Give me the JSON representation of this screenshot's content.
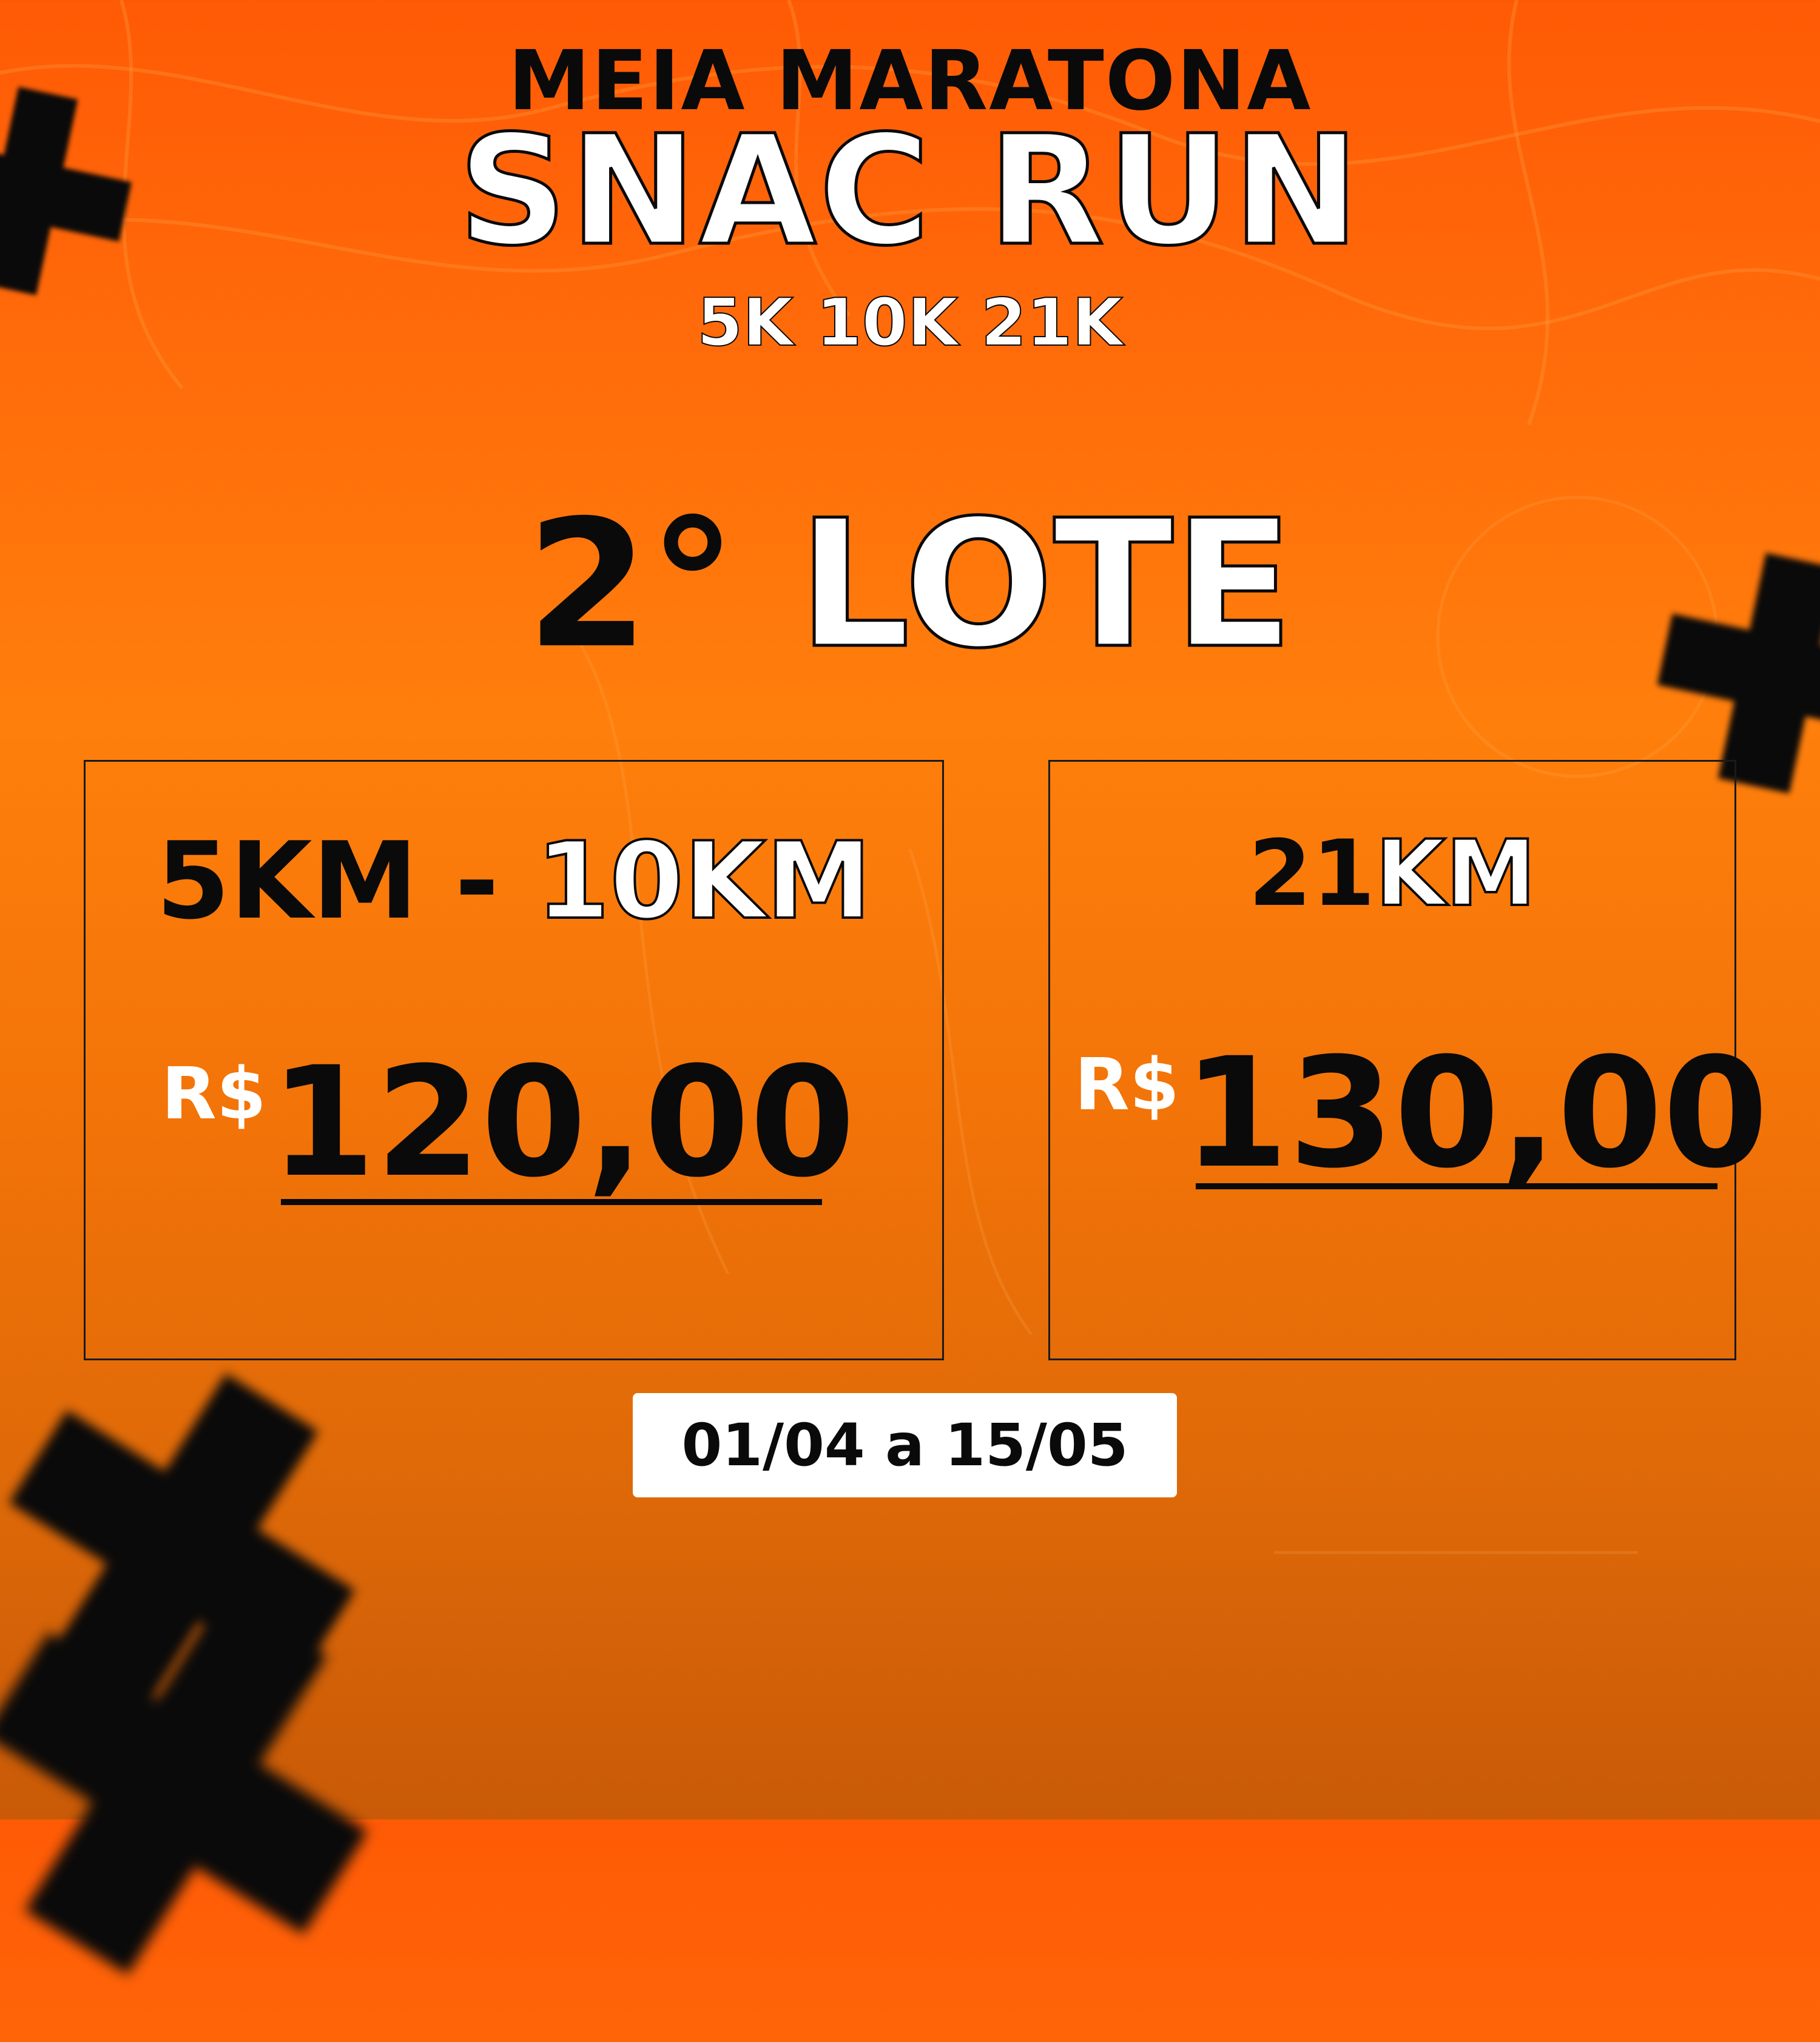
{
  "event": {
    "subtitle": "MEIA MARATONA",
    "title": "SNAC RUN",
    "distances": "5K 10K 21K"
  },
  "lot": {
    "number": "2°",
    "word": "LOTE"
  },
  "cards": [
    {
      "distance_part1": "5KM - ",
      "distance_part2": "10KM",
      "currency": "R$",
      "price": "120,00"
    },
    {
      "distance_part1": "21",
      "distance_part2": "KM",
      "currency": "R$",
      "price": "130,00"
    }
  ],
  "date_range": "01/04 a 15/05",
  "colors": {
    "background_top": "#ff5a05",
    "background_bottom": "#c95a07",
    "text_dark": "#0a0a0a",
    "text_light": "#ffffff"
  }
}
